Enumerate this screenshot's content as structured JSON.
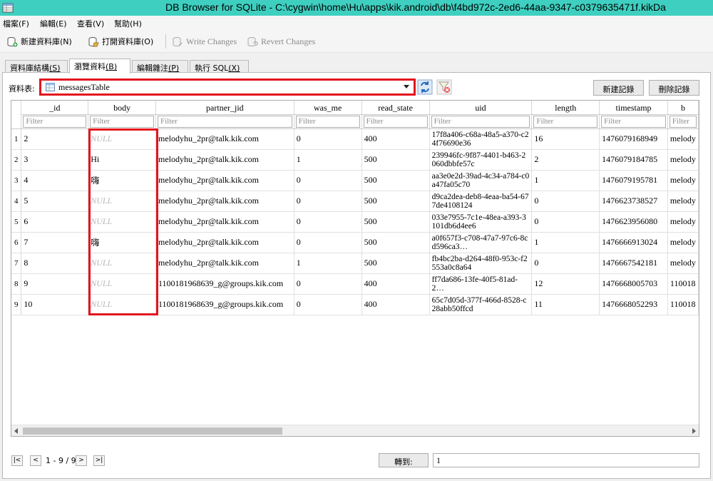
{
  "window": {
    "title": "DB Browser for SQLite - C:\\cygwin\\home\\Hu\\apps\\kik.android\\db\\f4bd972c-2ed6-44aa-9347-c0379635471f.kikDa"
  },
  "menu": [
    {
      "label": "檔案(F)"
    },
    {
      "label": "編輯(E)"
    },
    {
      "label": "查看(V)"
    },
    {
      "label": "幫助(H)"
    }
  ],
  "toolbar": {
    "new_db": "新建資料庫(N)",
    "open_db": "打開資料庫(O)",
    "write_changes": "Write Changes",
    "revert_changes": "Revert Changes"
  },
  "tabs": [
    {
      "label": "資料庫結構",
      "accel": "(S)"
    },
    {
      "label": "瀏覽資料",
      "accel": "(B)"
    },
    {
      "label": "編輯雜注",
      "accel": "(P)"
    },
    {
      "label": "執行 SQL",
      "accel": "(X)"
    }
  ],
  "browse": {
    "table_label": "資料表:",
    "table_selected": "messagesTable",
    "new_record": "新建記錄",
    "delete_record": "刪除記錄"
  },
  "grid": {
    "filter_placeholder": "Filter",
    "columns": [
      "_id",
      "body",
      "partner_jid",
      "was_me",
      "read_state",
      "uid",
      "length",
      "timestamp",
      "b"
    ],
    "rows": [
      [
        "1",
        "2",
        "NULL",
        "melodyhu_2pr@talk.kik.com",
        "0",
        "400",
        "17f8a406-c68a-48a5-a370-c24f76690e36",
        "16",
        "1476079168949",
        "melody"
      ],
      [
        "2",
        "3",
        "Hi",
        "melodyhu_2pr@talk.kik.com",
        "1",
        "500",
        "239946fc-9f87-4401-b463-2060dbbfe57c",
        "2",
        "1476079184785",
        "melody"
      ],
      [
        "3",
        "4",
        "嗨",
        "melodyhu_2pr@talk.kik.com",
        "0",
        "500",
        "aa3e0e2d-39ad-4c34-a784-c0a47fa05c70",
        "1",
        "1476079195781",
        "melody"
      ],
      [
        "4",
        "5",
        "NULL",
        "melodyhu_2pr@talk.kik.com",
        "0",
        "500",
        "d9ca2dea-deb8-4eaa-ba54-677de4108124",
        "0",
        "1476623738527",
        "melody"
      ],
      [
        "5",
        "6",
        "NULL",
        "melodyhu_2pr@talk.kik.com",
        "0",
        "500",
        "033e7955-7c1e-48ea-a393-3101db6d4ee6",
        "0",
        "1476623956080",
        "melody"
      ],
      [
        "6",
        "7",
        "嗨",
        "melodyhu_2pr@talk.kik.com",
        "0",
        "500",
        "a0f657f3-c708-47a7-97c6-8cd596ca3…",
        "1",
        "1476666913024",
        "melody"
      ],
      [
        "7",
        "8",
        "NULL",
        "melodyhu_2pr@talk.kik.com",
        "1",
        "500",
        "fb4bc2ba-d264-48f0-953c-f2553a0c8a64",
        "0",
        "1476667542181",
        "melody"
      ],
      [
        "8",
        "9",
        "NULL",
        "1100181968639_g@groups.kik.com",
        "0",
        "400",
        "ff7da686-13fe-40f5-81ad-2…",
        "12",
        "1476668005703",
        "110018"
      ],
      [
        "9",
        "10",
        "NULL",
        "1100181968639_g@groups.kik.com",
        "0",
        "400",
        "65c7d05d-377f-466d-8528-c28abb50ffcd",
        "11",
        "1476668052293",
        "110018"
      ]
    ]
  },
  "nav": {
    "first": "|<",
    "prev": "<",
    "range": "1 - 9 / 9",
    "next": ">",
    "last": ">|",
    "goto_label": "轉到:",
    "goto_value": "1"
  },
  "colors": {
    "title_bar": "#3ecfc0",
    "highlight": "#e3141e",
    "null_text": "#b8b8b8"
  }
}
